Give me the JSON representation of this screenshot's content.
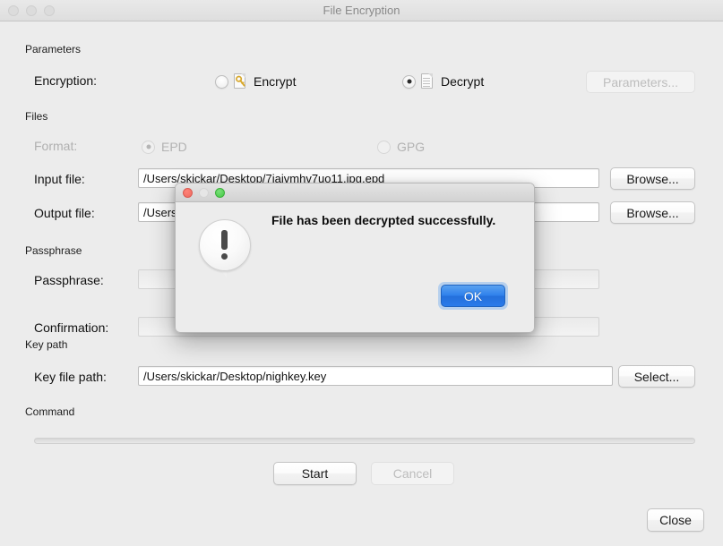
{
  "window": {
    "title": "File Encryption",
    "traffic_lights": [
      "close-button",
      "minimize-button",
      "zoom-button"
    ]
  },
  "groups": {
    "parameters": "Parameters",
    "files": "Files",
    "passphrase": "Passphrase",
    "key_path": "Key path",
    "command": "Command"
  },
  "encryption_row": {
    "label": "Encryption:",
    "options": [
      {
        "label": "Encrypt",
        "selected": false,
        "icon": "document-key-icon"
      },
      {
        "label": "Decrypt",
        "selected": true,
        "icon": "document-icon"
      }
    ],
    "parameters_button": "Parameters...",
    "parameters_button_enabled": false
  },
  "format_row": {
    "label": "Format:",
    "enabled": false,
    "options": [
      {
        "label": "EPD",
        "selected": true
      },
      {
        "label": "GPG",
        "selected": false
      }
    ]
  },
  "input_file": {
    "label": "Input file:",
    "value": "/Users/skickar/Desktop/7jaivmhv7uo11.jpg.epd",
    "browse_label": "Browse..."
  },
  "output_file": {
    "label": "Output file:",
    "value": "/Users/skickar/Desktop/7jaivmhv7uo11.jpg",
    "browse_label": "Browse..."
  },
  "passphrase_field": {
    "label": "Passphrase:",
    "value": "",
    "enabled": false
  },
  "confirmation_field": {
    "label": "Confirmation:",
    "value": "",
    "enabled": false
  },
  "key_file": {
    "label": "Key file path:",
    "value": "/Users/skickar/Desktop/nighkey.key",
    "select_label": "Select..."
  },
  "command_section": {
    "progress_percent": 0,
    "start_label": "Start",
    "cancel_label": "Cancel",
    "cancel_enabled": false
  },
  "close_button": "Close",
  "dialog": {
    "message": "File has been decrypted successfully.",
    "ok_label": "OK",
    "icon": "alert-bubble-icon",
    "traffic_lights": [
      "close-button",
      "minimize-button",
      "zoom-button"
    ]
  },
  "colors": {
    "window_bg": "#ececec",
    "accent_blue": "#2f81ec",
    "title_text": "#8a8a8a",
    "disabled_text": "#b5b5b5"
  }
}
